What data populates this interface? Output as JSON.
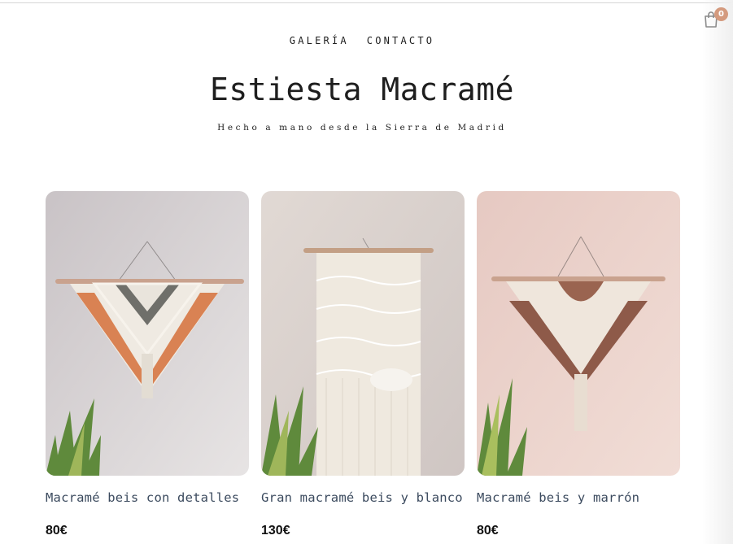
{
  "cart": {
    "count": "0",
    "icon": "shopping-bag-icon",
    "badge_color": "#d49a7e"
  },
  "nav": {
    "items": [
      {
        "label": "GALERÍA"
      },
      {
        "label": "CONTACTO"
      }
    ]
  },
  "site": {
    "title": "Estiesta Macramé",
    "tagline": "Hecho a mano desde la Sierra de Madrid"
  },
  "products": [
    {
      "name": "Macramé beis con detalles",
      "price": "80€",
      "accent": "#d98253"
    },
    {
      "name": "Gran macramé beis y blanco",
      "price": "130€",
      "accent": "#e8e1d4"
    },
    {
      "name": "Macramé beis y marrón",
      "price": "80€",
      "accent": "#8e5a49"
    }
  ],
  "colors": {
    "text": "#1e1e1e",
    "product_name": "#3b4a5e"
  }
}
